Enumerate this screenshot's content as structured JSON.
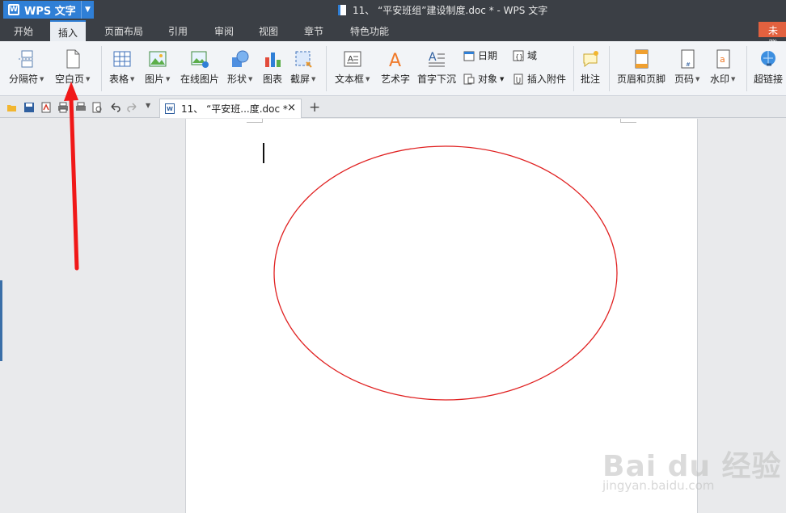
{
  "app": {
    "name": "WPS 文字"
  },
  "window_title": "11、 “平安班组”建设制度.doc * - WPS 文字",
  "menu_tabs": [
    "开始",
    "插入",
    "页面布局",
    "引用",
    "审阅",
    "视图",
    "章节",
    "特色功能"
  ],
  "active_tab": "插入",
  "login_label": "未登",
  "ribbon": {
    "page_break": "分隔符",
    "blank_page": "空白页",
    "table": "表格",
    "picture": "图片",
    "online_picture": "在线图片",
    "shape": "形状",
    "chart": "图表",
    "screenshot": "截屏",
    "textbox": "文本框",
    "wordart": "艺术字",
    "drop_cap": "首字下沉",
    "date": "日期",
    "field": "域",
    "object": "对象",
    "attachment": "插入附件",
    "comment": "批注",
    "header_footer": "页眉和页脚",
    "page_number": "页码",
    "watermark": "水印",
    "hyperlink": "超链接"
  },
  "doc_tab": {
    "label": "11、 “平安班...度.doc *",
    "close": "×"
  },
  "new_tab": "+",
  "watermark": {
    "brand": "Bai du 经验",
    "url": "jingyan.baidu.com"
  },
  "colors": {
    "accent": "#2f7fd6",
    "ellipse_stroke": "#e02020",
    "arrow": "#f01818",
    "login": "#e2613f"
  },
  "icons": [
    "folder-open-icon",
    "save-icon",
    "pdf-icon",
    "print-icon",
    "print-preview-icon",
    "undo-icon",
    "redo-icon"
  ]
}
